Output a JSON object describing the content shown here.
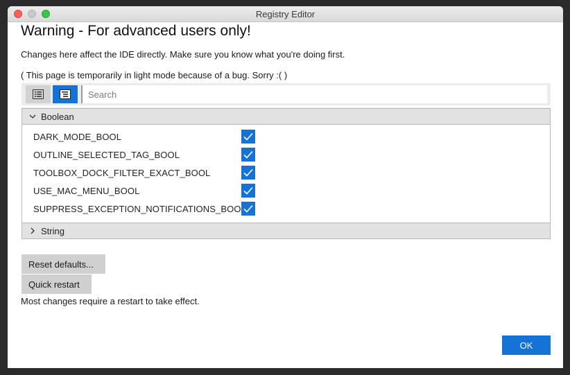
{
  "window": {
    "title": "Registry Editor"
  },
  "heading": "Warning - For advanced users only!",
  "description": "Changes here affect the IDE directly. Make sure you know what you're doing first.",
  "notice": "( This page is temporarily in light mode because of a bug. Sorry :(  )",
  "toolbar": {
    "list_view_icon": "list-icon",
    "tree_view_icon": "tree-list-icon",
    "search_placeholder": "Search",
    "search_value": ""
  },
  "groups": {
    "boolean": {
      "label": "Boolean",
      "expanded": true,
      "items": [
        {
          "label": "DARK_MODE_BOOL",
          "checked": true
        },
        {
          "label": "OUTLINE_SELECTED_TAG_BOOL",
          "checked": true
        },
        {
          "label": "TOOLBOX_DOCK_FILTER_EXACT_BOOL",
          "checked": true
        },
        {
          "label": "USE_MAC_MENU_BOOL",
          "checked": true
        },
        {
          "label": "SUPPRESS_EXCEPTION_NOTIFICATIONS_BOOL",
          "checked": true
        }
      ]
    },
    "string": {
      "label": "String",
      "expanded": false
    }
  },
  "buttons": {
    "reset": "Reset defaults...",
    "restart": "Quick restart",
    "ok": "OK"
  },
  "restart_note": "Most changes require a restart to take effect.",
  "colors": {
    "accent": "#1673d6",
    "header_bg": "#e2e2e2",
    "button_bg": "#d0d0d0"
  }
}
